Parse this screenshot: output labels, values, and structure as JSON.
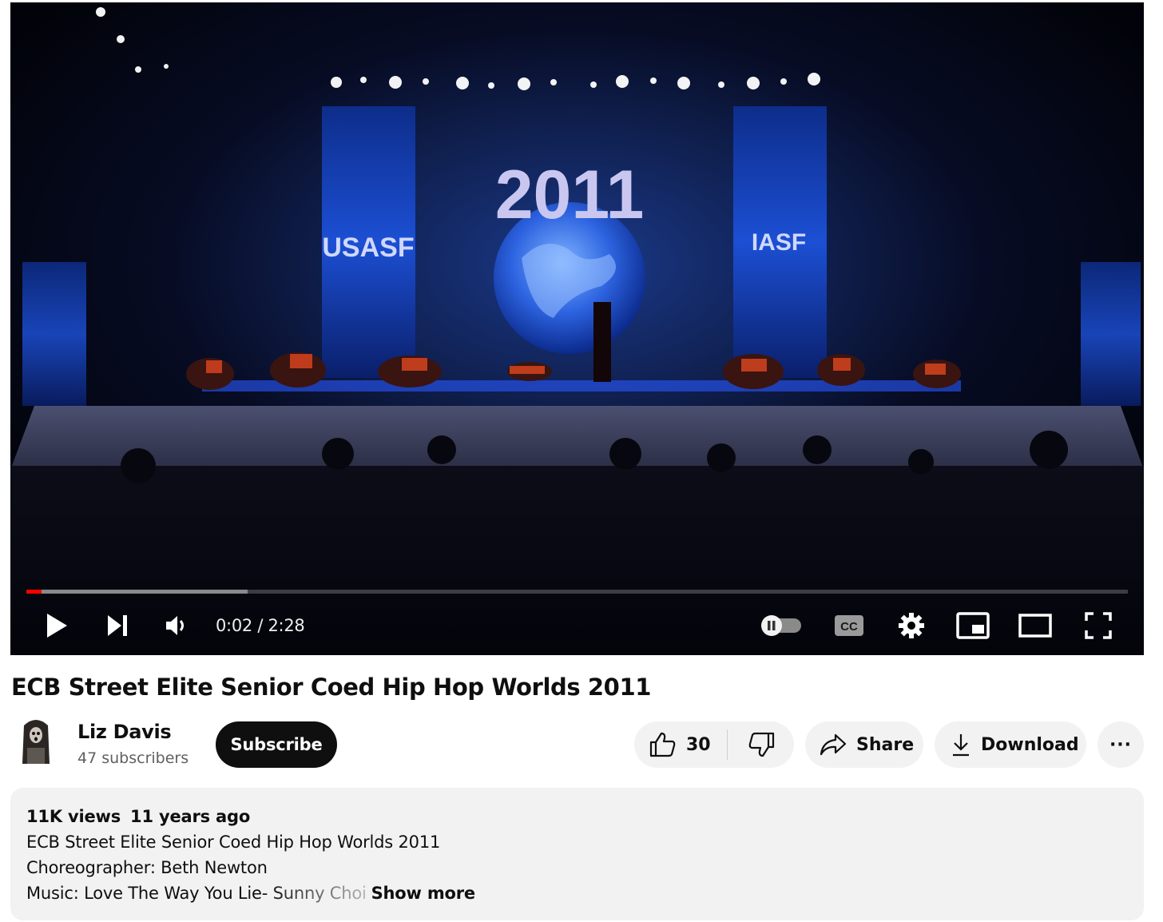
{
  "player": {
    "time_display": "0:02 / 2:28",
    "progress": {
      "played_fraction": 0.014,
      "buffered_fraction": 0.201
    },
    "controls": [
      {
        "name": "play-icon"
      },
      {
        "name": "next-icon"
      },
      {
        "name": "volume-icon"
      },
      {
        "name": "autoplay-toggle-icon"
      },
      {
        "name": "captions-icon",
        "label": "CC"
      },
      {
        "name": "gear-icon"
      },
      {
        "name": "miniplayer-icon"
      },
      {
        "name": "theater-mode-icon"
      },
      {
        "name": "fullscreen-icon"
      }
    ],
    "stage_text": {
      "year": "2011",
      "banner_left": "USASF",
      "banner_right": "IASF"
    }
  },
  "video": {
    "title": "ECB Street Elite Senior Coed Hip Hop Worlds 2011"
  },
  "channel": {
    "name": "Liz Davis",
    "subscribers": "47 subscribers",
    "subscribe_label": "Subscribe"
  },
  "actions": {
    "like_count": "30",
    "share_label": "Share",
    "download_label": "Download",
    "more_label": "···"
  },
  "description": {
    "views": "11K views",
    "date": "11 years ago",
    "lines": [
      "ECB Street Elite Senior Coed Hip Hop Worlds 2011",
      "Choreographer: Beth Newton",
      "Music: Love The Way You Lie- Sunny Choi"
    ],
    "show_more_label": "Show more"
  },
  "colors": {
    "accent_red": "#ff0000",
    "button_dark": "#0f0f0f",
    "pill_bg": "#f2f2f2",
    "stage_blue": "#1e4fd0"
  }
}
